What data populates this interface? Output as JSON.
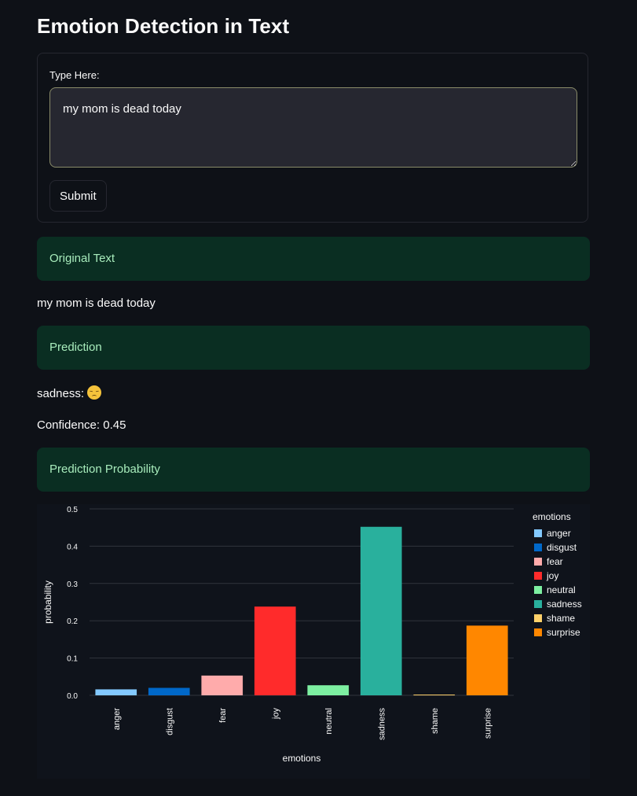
{
  "app": {
    "title": "Emotion Detection in Text"
  },
  "form": {
    "input_label": "Type Here:",
    "input_value": "my mom is dead today",
    "submit_label": "Submit"
  },
  "sections": {
    "original": "Original Text",
    "prediction": "Prediction",
    "probability": "Prediction Probability"
  },
  "results": {
    "original_text": "my mom is dead today",
    "prediction_label": "sadness:",
    "prediction_emoji": "pensive-face-icon",
    "confidence_text": "Confidence: 0.45"
  },
  "colors": {
    "section_bg": "#0a2e22",
    "section_text": "#a8ecbc",
    "page_bg": "#0e1117"
  },
  "chart_data": {
    "type": "bar",
    "xlabel": "emotions",
    "ylabel": "probability",
    "legend_title": "emotions",
    "legend_position": "top-right",
    "ylim": [
      0,
      0.5
    ],
    "yticks": [
      "0.0",
      "0.1",
      "0.2",
      "0.3",
      "0.4",
      "0.5"
    ],
    "grid": true,
    "categories": [
      "anger",
      "disgust",
      "fear",
      "joy",
      "neutral",
      "sadness",
      "shame",
      "surprise"
    ],
    "values": [
      0.016,
      0.02,
      0.053,
      0.238,
      0.027,
      0.452,
      0.002,
      0.187
    ],
    "colors": [
      "#83c9ff",
      "#0068c9",
      "#ffabab",
      "#ff2b2b",
      "#7defa1",
      "#29b09d",
      "#ffd16a",
      "#ff8700"
    ]
  }
}
